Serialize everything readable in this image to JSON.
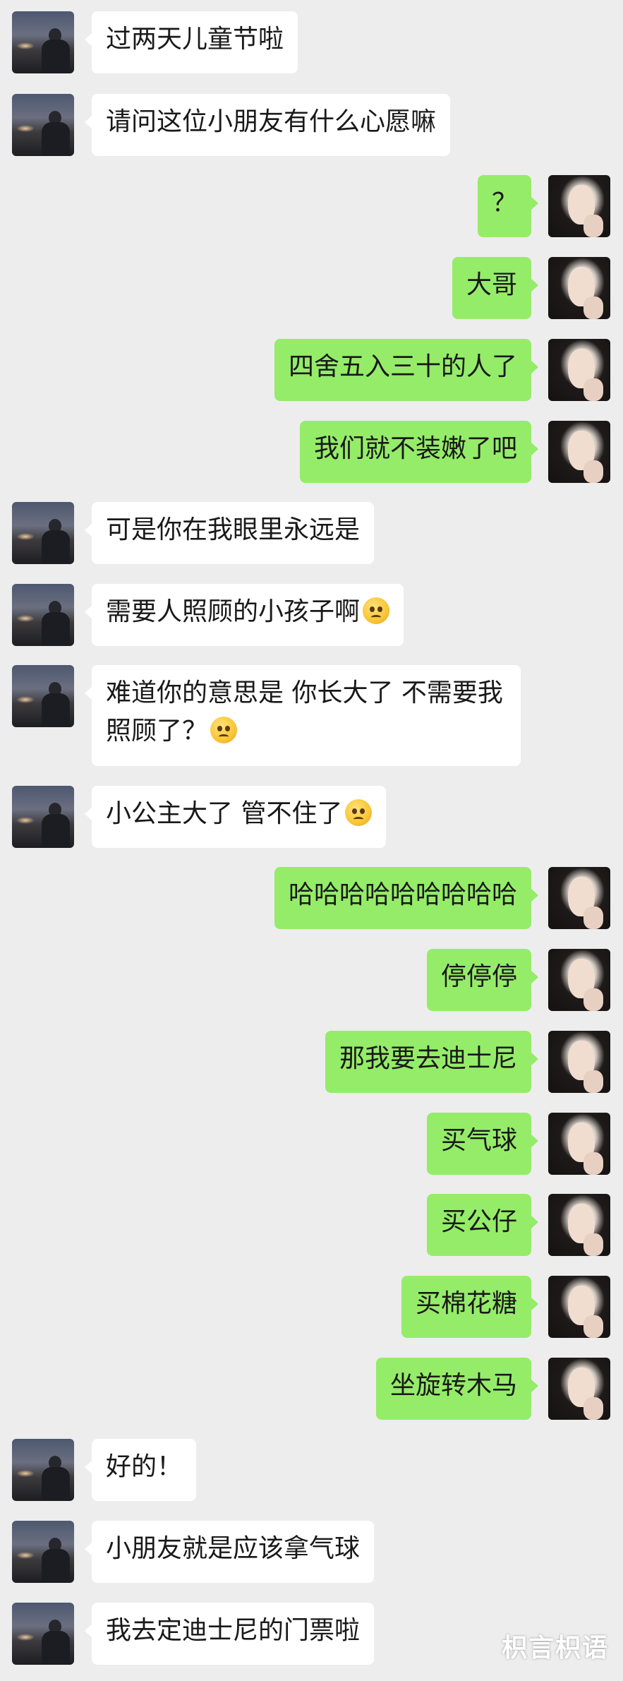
{
  "chat": {
    "messages": [
      {
        "side": "left",
        "text": "过两天儿童节啦"
      },
      {
        "side": "left",
        "text": "请问这位小朋友有什么心愿嘛"
      },
      {
        "side": "right",
        "text": "？"
      },
      {
        "side": "right",
        "text": "大哥"
      },
      {
        "side": "right",
        "text": "四舍五入三十的人了"
      },
      {
        "side": "right",
        "text": "我们就不装嫩了吧"
      },
      {
        "side": "left",
        "text": "可是你在我眼里永远是"
      },
      {
        "side": "left",
        "text": "需要人照顾的小孩子啊",
        "emoji": "sad-face-emoji"
      },
      {
        "side": "left",
        "text": "难道你的意思是  你长大了  不需要我照顾了？",
        "emoji": "sad-face-emoji"
      },
      {
        "side": "left",
        "text": "小公主大了 管不住了",
        "emoji": "sad-face-emoji"
      },
      {
        "side": "right",
        "text": "哈哈哈哈哈哈哈哈哈"
      },
      {
        "side": "right",
        "text": "停停停"
      },
      {
        "side": "right",
        "text": "那我要去迪士尼"
      },
      {
        "side": "right",
        "text": "买气球"
      },
      {
        "side": "right",
        "text": "买公仔"
      },
      {
        "side": "right",
        "text": "买棉花糖"
      },
      {
        "side": "right",
        "text": "坐旋转木马"
      },
      {
        "side": "left",
        "text": "好的！"
      },
      {
        "side": "left",
        "text": "小朋友就是应该拿气球"
      },
      {
        "side": "left",
        "text": "我去定迪士尼的门票啦"
      }
    ]
  },
  "watermark": "枳言枳语",
  "colors": {
    "background": "#ededed",
    "left_bubble": "#ffffff",
    "right_bubble": "#95ec69",
    "text": "#191919"
  }
}
